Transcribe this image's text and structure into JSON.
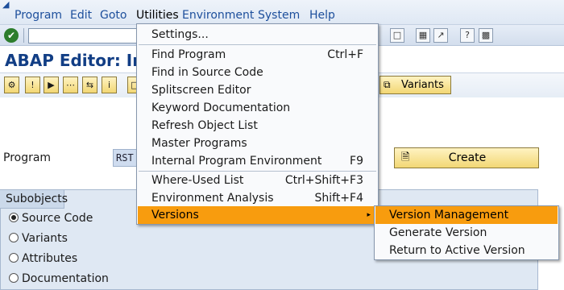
{
  "menubar": {
    "items": [
      "Program",
      "Edit",
      "Goto",
      "Utilities",
      "Environment",
      "System",
      "Help"
    ]
  },
  "page": {
    "title": "ABAP Editor: Ir"
  },
  "app_toolbar": {
    "variants_label": "Variants"
  },
  "program": {
    "label": "Program",
    "value": "RST",
    "create_label": "Create"
  },
  "subobjects": {
    "title": "Subobjects",
    "options": [
      {
        "label": "Source Code",
        "selected": true
      },
      {
        "label": "Variants",
        "selected": false
      },
      {
        "label": "Attributes",
        "selected": false
      },
      {
        "label": "Documentation",
        "selected": false
      }
    ]
  },
  "utilities_menu": {
    "items": [
      {
        "label": "Settings...",
        "shortcut": ""
      },
      {
        "label": "Find Program",
        "shortcut": "Ctrl+F"
      },
      {
        "label": "Find in Source Code",
        "shortcut": ""
      },
      {
        "label": "Splitscreen Editor",
        "shortcut": ""
      },
      {
        "label": "Keyword Documentation",
        "shortcut": ""
      },
      {
        "label": "Refresh Object List",
        "shortcut": ""
      },
      {
        "label": "Master Programs",
        "shortcut": ""
      },
      {
        "label": "Internal Program Environment",
        "shortcut": "F9"
      },
      {
        "label": "Where-Used List",
        "shortcut": "Ctrl+Shift+F3"
      },
      {
        "label": "Environment Analysis",
        "shortcut": "Shift+F4"
      },
      {
        "label": "Versions",
        "shortcut": ""
      }
    ]
  },
  "versions_menu": {
    "items": [
      {
        "label": "Version Management"
      },
      {
        "label": "Generate Version"
      },
      {
        "label": "Return to Active Version"
      }
    ]
  },
  "colors": {
    "highlight": "#f89c0e",
    "title": "#123e85",
    "menu_text": "#1d4f9c"
  }
}
